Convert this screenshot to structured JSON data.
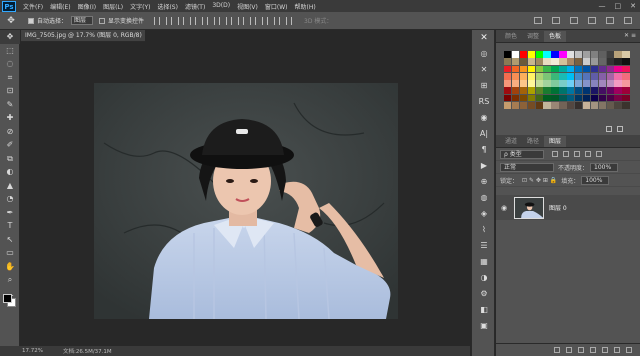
{
  "app": {
    "logo": "Ps"
  },
  "menu": [
    "文件(F)",
    "编辑(E)",
    "图像(I)",
    "图层(L)",
    "文字(Y)",
    "选择(S)",
    "滤镜(T)",
    "3D(D)",
    "视图(V)",
    "窗口(W)",
    "帮助(H)"
  ],
  "window_controls": {
    "minimize": "—",
    "maximize": "□",
    "close": "✕"
  },
  "options": {
    "move_glyph": "✥",
    "auto_select_label": "自动选择：",
    "auto_select_value": "图层",
    "show_transform_label": "显示变换控件",
    "mode_3d_label": "3D 模式："
  },
  "document": {
    "tab_title": "IMG_7505.jpg @ 17.7% (图层 0, RGB/8) *"
  },
  "status": {
    "zoom": "17.72%",
    "doc_info": "文档:26.5M/37.1M"
  },
  "tools": [
    "✥",
    "⬚",
    "◌",
    "⌗",
    "⊡",
    "✎",
    "✚",
    "⊘",
    "✐",
    "⧉",
    "◐",
    "▲",
    "◔",
    "✒",
    "T",
    "↖",
    "▭",
    "✋",
    "⌕",
    "…"
  ],
  "strip": [
    {
      "glyph": "✕",
      "name": "close-icon"
    },
    {
      "glyph": "◎",
      "name": "history-icon"
    },
    {
      "glyph": "✕",
      "name": "brush-x-icon"
    },
    {
      "glyph": "⊞",
      "name": "properties-icon"
    },
    {
      "glyph": "RS",
      "name": "rs-plugin-icon"
    },
    {
      "glyph": "◉",
      "name": "c-plugin-icon"
    },
    {
      "glyph": "A|",
      "name": "character-icon"
    },
    {
      "glyph": "¶",
      "name": "paragraph-icon"
    },
    {
      "glyph": "▶",
      "name": "actions-icon"
    },
    {
      "glyph": "⊕",
      "name": "adjust-icon"
    },
    {
      "glyph": "◍",
      "name": "styles-icon"
    },
    {
      "glyph": "◈",
      "name": "channels-icon"
    },
    {
      "glyph": "⌇",
      "name": "paths-icon"
    },
    {
      "glyph": "☰",
      "name": "info-icon"
    },
    {
      "glyph": "▦",
      "name": "navigator-icon"
    },
    {
      "glyph": "◑",
      "name": "color-icon"
    },
    {
      "glyph": "⚙",
      "name": "settings-icon"
    },
    {
      "glyph": "◧",
      "name": "libraries-icon"
    },
    {
      "glyph": "▣",
      "name": "clone-icon"
    }
  ],
  "color_panel": {
    "tabs": [
      "颜色",
      "调整",
      "色板"
    ],
    "active_tab_index": 2,
    "close": "✕ ≡"
  },
  "swatch_rows": [
    [
      "#000000",
      "#ffffff",
      "#ff0000",
      "#ffff00",
      "#00ff00",
      "#00ffff",
      "#0000ff",
      "#ff00ff",
      "#e0e0e0",
      "#c0c0c0",
      "#a0a0a0",
      "#808080",
      "#606060",
      "#404040",
      "#b7a179",
      "#d9c9a6"
    ],
    [
      "#8a7a55",
      "#b09c6f",
      "#6b5a3a",
      "#c8b68e",
      "#a08a60",
      "#e8dcc0",
      "#f2ead6",
      "#d4c19a",
      "#aa8866",
      "#7a6040",
      "#cccccc",
      "#999999",
      "#666666",
      "#333333",
      "#222222",
      "#111111"
    ],
    [
      "#ed1c24",
      "#f26522",
      "#f7941d",
      "#fff200",
      "#8dc63f",
      "#39b54a",
      "#00a651",
      "#00a99d",
      "#00aeef",
      "#0072bc",
      "#0054a6",
      "#2e3192",
      "#662d91",
      "#92278f",
      "#ec008c",
      "#ed145b"
    ],
    [
      "#f26c4f",
      "#f68e55",
      "#fbaf5c",
      "#fff467",
      "#acd372",
      "#7cc576",
      "#3bb878",
      "#1abbb4",
      "#00bff3",
      "#438cca",
      "#5574b9",
      "#605ca8",
      "#855fa8",
      "#a763a8",
      "#f06eaa",
      "#f26d7d"
    ],
    [
      "#f7977a",
      "#f9ad81",
      "#fdc68a",
      "#fff79a",
      "#c4df9b",
      "#a3d39c",
      "#82ca9d",
      "#7bcdc8",
      "#6ecff6",
      "#7ea7d8",
      "#8493ca",
      "#8882be",
      "#a187be",
      "#bc8dbf",
      "#f49ac2",
      "#f6989d"
    ],
    [
      "#9e0b0f",
      "#a0410d",
      "#a3620a",
      "#aba000",
      "#598527",
      "#1a7b30",
      "#007236",
      "#00746b",
      "#0076a3",
      "#004b80",
      "#003471",
      "#1b1464",
      "#440e62",
      "#630460",
      "#9e005d",
      "#9e0039"
    ],
    [
      "#790000",
      "#7b2e00",
      "#7d4900",
      "#827b00",
      "#406618",
      "#005e20",
      "#005826",
      "#005952",
      "#005b7f",
      "#003663",
      "#002157",
      "#0d004c",
      "#32004b",
      "#4b0049",
      "#7b0046",
      "#7a0026"
    ],
    [
      "#c69c6d",
      "#a67c52",
      "#8c6239",
      "#754c24",
      "#603913",
      "#c2b59b",
      "#998675",
      "#736357",
      "#534741",
      "#362f2d",
      "#c7b299",
      "#a39481",
      "#837565",
      "#655a4e",
      "#4d453e",
      "#3a332d"
    ]
  ],
  "layers_panel": {
    "tabs": [
      "通道",
      "路径",
      "图层"
    ],
    "active_tab_index": 2,
    "filter_kind": "ρ 类型",
    "blend_mode": "正常",
    "opacity_label": "不透明度：",
    "opacity_value": "100%",
    "lock_label": "锁定：",
    "lock_icons": "⊡ ✎ ✥ ⊞ 🔒",
    "fill_label": "填充：",
    "fill_value": "100%",
    "layer_name": "图层 0",
    "eye_glyph": "◉"
  }
}
